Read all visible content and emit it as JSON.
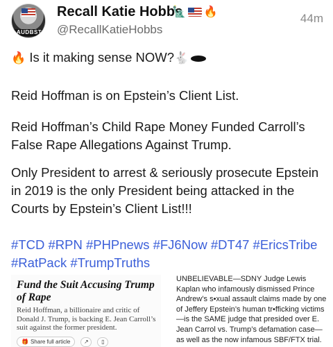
{
  "author": {
    "name": "Recall Katie Hobbs",
    "handle": "@RecallKatieHobbs",
    "avatar_stamp": "AUDBST",
    "name_emojis": [
      "statue-of-liberty-icon",
      "us-flag-icon",
      "fire-icon"
    ]
  },
  "time": "44m",
  "post": {
    "line1": "Is it making sense NOW?",
    "line1_emojis": [
      "fire-icon",
      "rabbit-icon",
      "hole-icon"
    ],
    "p2": "Reid Hoffman is on Epstein’s Client List.",
    "p3": "Reid Hoffman’s Child Rape Money Funded Carroll’s False Rape Allegations Against Trump.",
    "p4": "Only President to arrest & seriously prosecute Epstein in 2019 is the only President being attacked in the Courts by Epstein’s Client List!!!",
    "hashtags": "#TCD #RPN #PHPnews #FJ6Now #DT47 #EricsTribe #RatPack #TrumpTruths"
  },
  "article": {
    "headline": "Fund the Suit Accusing Trump of Rape",
    "body": "Reid Hoffman, a billionaire and critic of Donald J. Trump, is backing E. Jean Carroll’s suit against the former president.",
    "share_label": "Share full article"
  },
  "note": "UNBELIEVABLE—SDNY Judge Lewis Kaplan who infamously dismissed Prince Andrew’s s•xual assault claims made by one of Jeffery Epstein’s human tr•fficking victims—is the SAME judge that presided over E. Jean Carrol vs. Trump’s defamation case—as well as the now infamous SBF/FTX trial.",
  "colors": {
    "hashtag": "#3b5fd9",
    "muted": "#6b6b6b"
  }
}
